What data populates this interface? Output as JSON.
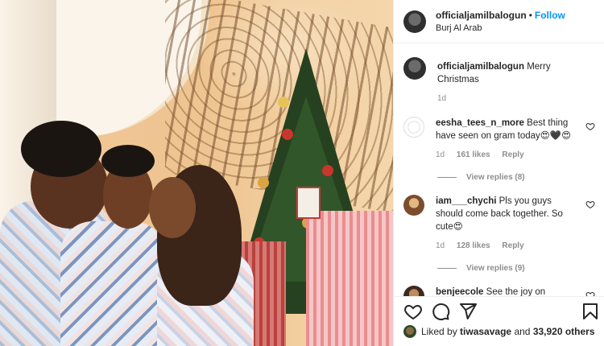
{
  "post": {
    "username": "officialjamilbalogun",
    "follow_label": "Follow",
    "location": "Burj Al Arab",
    "caption_username": "officialjamilbalogun",
    "caption_text": "Merry Christmas",
    "caption_age": "1d"
  },
  "comments": [
    {
      "username": "eesha_tees_n_more",
      "text": "Best thing have seen on gram today😍🖤😍",
      "age": "1d",
      "likes": "161 likes",
      "reply_label": "Reply",
      "view_replies": "View replies (8)"
    },
    {
      "username": "iam___chychi",
      "text": "Pls you guys should come back together. So cute😍",
      "age": "1d",
      "likes": "128 likes",
      "reply_label": "Reply",
      "view_replies": "View replies (9)"
    },
    {
      "username": "benjeecole",
      "text": "See the joy on Jamiam's face😂😂😂thanks for"
    }
  ],
  "likes_bar": {
    "prefix": "Liked by",
    "user": "tiwasavage",
    "suffix": "and",
    "count": "33,920 others"
  },
  "icons": {
    "like": "heart-icon",
    "comment": "comment-icon",
    "share": "share-icon",
    "save": "bookmark-icon"
  },
  "colors": {
    "follow": "#0095f6",
    "muted": "#8e8e8e",
    "text": "#262626"
  }
}
